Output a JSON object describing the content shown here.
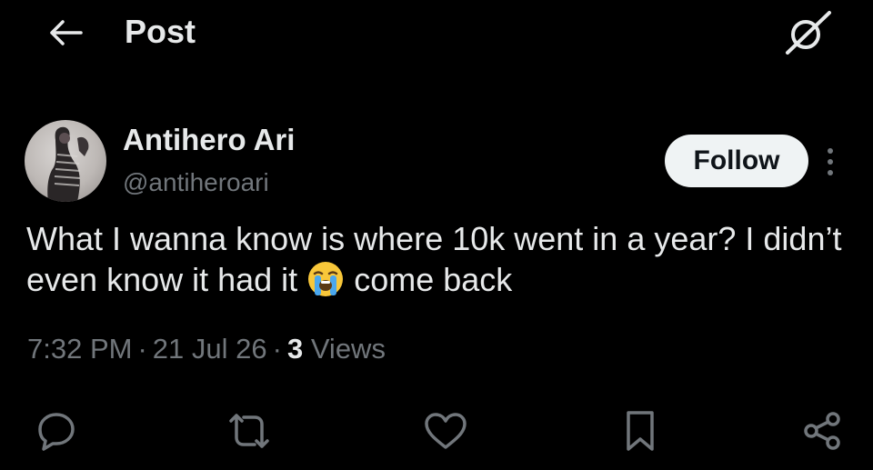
{
  "header": {
    "title": "Post",
    "back_icon": "arrow-left-icon",
    "grok_icon": "grok-icon"
  },
  "post": {
    "author": {
      "display_name": "Antihero Ari",
      "handle": "@antiheroari"
    },
    "follow_label": "Follow",
    "text_part1": "What I wanna know is where 10k went in a year? I didn’t even know it had it",
    "emoji": "loudly-crying-face",
    "text_part2": "come back",
    "time": "7:32 PM",
    "dot1": "·",
    "date": "21 Jul 26",
    "dot2": "·",
    "views_count": "3",
    "views_label": "Views"
  },
  "actions": [
    "reply-icon",
    "repost-icon",
    "like-icon",
    "bookmark-icon",
    "share-icon"
  ],
  "colors": {
    "background": "#000000",
    "text_primary": "#e7e9ea",
    "text_secondary": "#71767b",
    "follow_bg": "#eff3f4"
  }
}
